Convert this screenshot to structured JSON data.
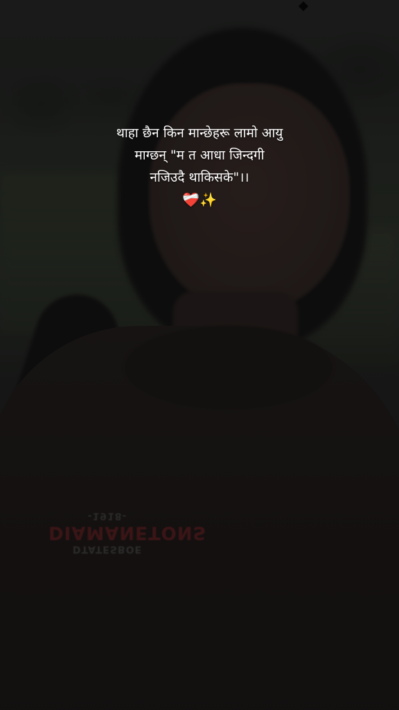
{
  "caption": {
    "line1": "थाहा छैन किन मान्छेहरू लामो आयु",
    "line2": "माग्छन् \"म त आधा जिन्दगी",
    "line3": "नजिउदै थाकिसके\"।।",
    "emojis": "❤️‍🩹✨"
  },
  "shirt_print": {
    "line1": "DTATESBOE",
    "line2": "DIAMANETONS",
    "line3": "-1918-"
  }
}
